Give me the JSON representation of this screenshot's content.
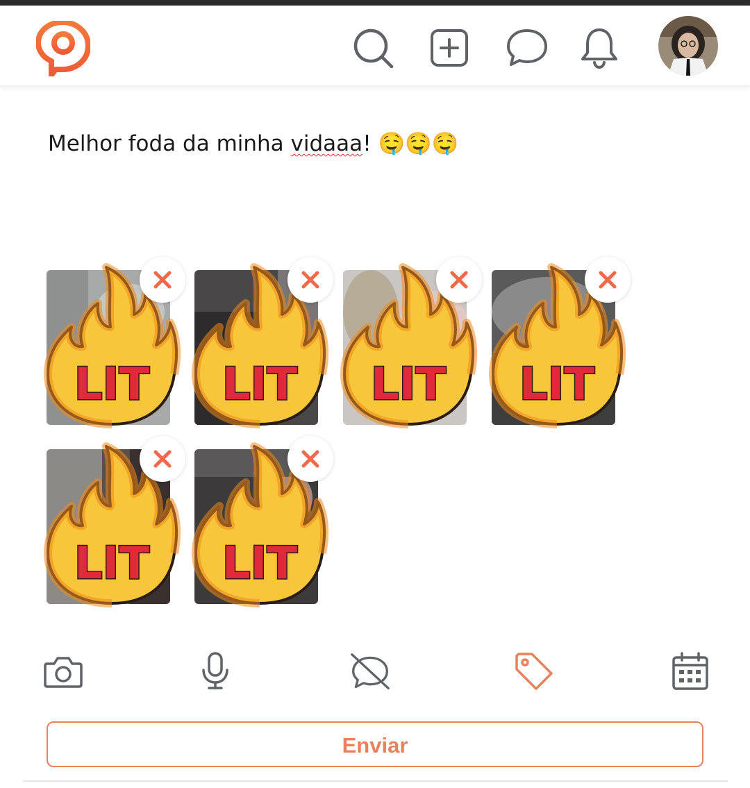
{
  "header": {
    "logo": "app-logo",
    "icons": [
      "search-icon",
      "add-post-icon",
      "messages-icon",
      "notifications-icon"
    ],
    "avatar": "profile-avatar"
  },
  "post": {
    "text_before": "Melhor foda da minha ",
    "text_misspelled": "vidaaa",
    "text_after": "! 🤤🤤🤤"
  },
  "attachments": [
    {
      "sticker_text": "LIT"
    },
    {
      "sticker_text": "LIT"
    },
    {
      "sticker_text": "LIT"
    },
    {
      "sticker_text": "LIT"
    },
    {
      "sticker_text": "LIT"
    },
    {
      "sticker_text": "LIT"
    }
  ],
  "toolbar": {
    "icons": [
      "camera-icon",
      "microphone-icon",
      "hide-comments-icon",
      "tag-icon",
      "calendar-icon"
    ],
    "active": "tag-icon"
  },
  "send_button": {
    "label": "Enviar"
  },
  "colors": {
    "accent": "#e9825c",
    "icon_gray": "#5f6368",
    "remove_x": "#ef6a4a"
  }
}
